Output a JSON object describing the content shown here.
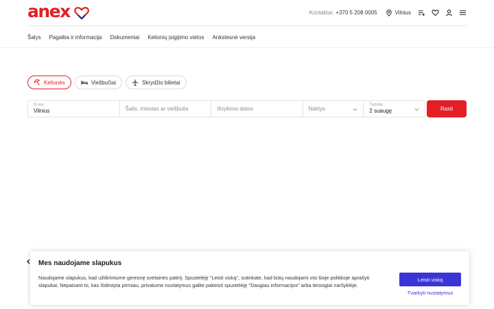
{
  "header": {
    "logo_text": "anex",
    "contact_label": "Kontaktai:",
    "contact_phone": "+370 5 208 0005",
    "location": "Vilnius",
    "icons": [
      "playlist-add-icon",
      "heart-icon",
      "user-icon",
      "menu-icon"
    ]
  },
  "nav": {
    "items": [
      "Šalys",
      "Pagalba ir informacija",
      "Dokumentai",
      "Kelionių įsigijimo vietos",
      "Ankstesnė versija"
    ]
  },
  "search": {
    "tabs": [
      {
        "label": "Kelionės",
        "icon": "beach-umbrella-icon",
        "active": true
      },
      {
        "label": "Viešbučiai",
        "icon": "bed-icon",
        "active": false
      },
      {
        "label": "Skrydžio bilietai",
        "icon": "airplane-icon",
        "active": false
      }
    ],
    "from_label": "Iš kur",
    "from_value": "Vilnius",
    "destination_placeholder": "Šalis, miestas ar viešbutis",
    "date_placeholder": "Išvykimo datos",
    "nights_placeholder": "Naktys",
    "tourists_label": "Turistai",
    "tourists_value": "2 suaugę",
    "submit_label": "Rasti"
  },
  "cookie": {
    "title": "Mes naudojame slapukus",
    "text": "Naudojame slapukus, kad užtikrintume geresnę svetainės patirtį. Spustelėję \"Leisti viską\", sutinkate, kad būtų naudojami visi šioje politikoje aprašyti slapukai. Nepaisant to, kas išdėstyta pirmiau, privatumo nustatymus galite pakeisti spustelėję \"Daugiau informacijos\" arba tiesiogiai naršyklėje.",
    "allow_label": "Leisti viską",
    "manage_label": "Tvarkyti nustatymus"
  },
  "colors": {
    "brand_red": "#e31e24",
    "brand_navy": "#2b2f7a",
    "cookie_accent": "#3b34d6"
  }
}
